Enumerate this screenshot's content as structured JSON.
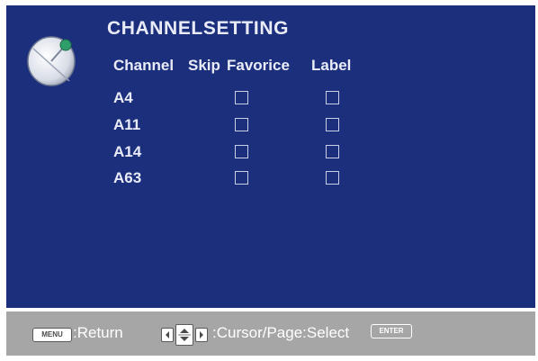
{
  "title": "CHANNELSETTING",
  "headers": [
    "Channel",
    "Skip",
    "Favorice",
    "Label"
  ],
  "rows": [
    {
      "channel": "A4",
      "skip": false,
      "favorite": false
    },
    {
      "channel": "A11",
      "skip": false,
      "favorite": false
    },
    {
      "channel": "A14",
      "skip": false,
      "favorite": false
    },
    {
      "channel": "A63",
      "skip": false,
      "favorite": false
    }
  ],
  "footer": {
    "menu_key": "MENU",
    "return_text": ":Return",
    "cursor_text": ":Cursor/Page:Select",
    "enter_key": "ENTER"
  },
  "colors": {
    "panel": "#1c2f7d",
    "footer": "#a6a6a6",
    "text": "#e9ecf7"
  },
  "icons": [
    "satellite-dish-icon",
    "left-arrow-icon",
    "up-down-arrow-icon",
    "right-arrow-icon"
  ]
}
